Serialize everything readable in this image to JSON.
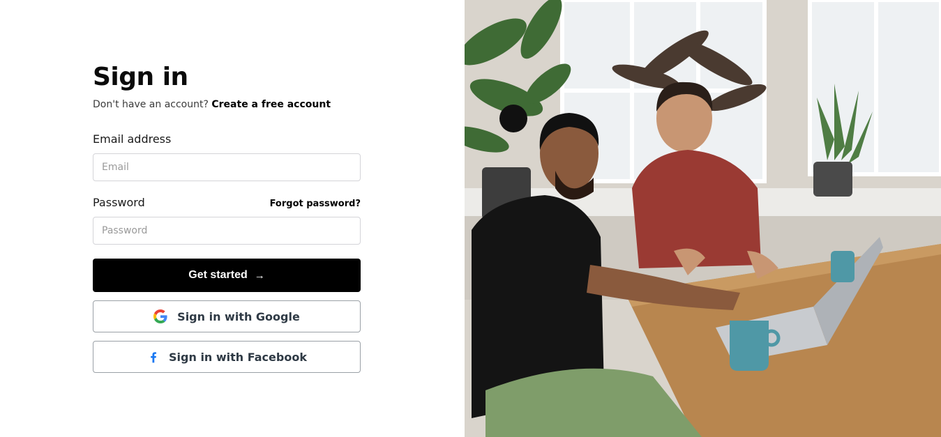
{
  "signin": {
    "title": "Sign in",
    "no_account_text": "Don't have an account?",
    "create_account_link": "Create a free account",
    "email_label": "Email address",
    "email_placeholder": "Email",
    "password_label": "Password",
    "forgot_link": "Forgot password?",
    "password_placeholder": "Password",
    "submit_label": "Get started",
    "submit_icon": "arrow-right-icon",
    "google_label": "Sign in with Google",
    "google_icon": "google-icon",
    "facebook_label": "Sign in with Facebook",
    "facebook_icon": "facebook-icon"
  },
  "colors": {
    "primary_button": "#000000",
    "facebook_blue": "#1877F2",
    "google_blue": "#4285F4",
    "google_red": "#EA4335",
    "google_yellow": "#FBBC05",
    "google_green": "#34A853"
  }
}
